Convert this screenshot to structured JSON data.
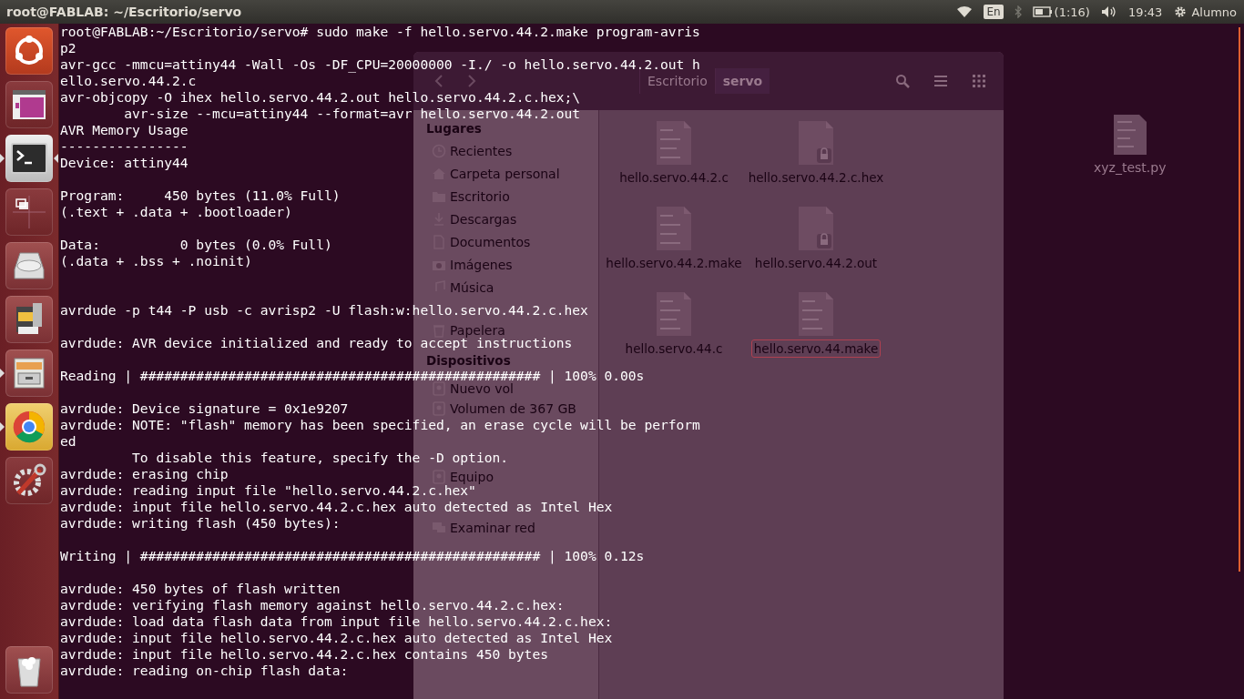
{
  "top_panel": {
    "title": "root@FABLAB: ~/Escritorio/servo",
    "keyboard": "En",
    "battery_time": "(1:16)",
    "clock": "19:43",
    "user": "Alumno"
  },
  "launcher": [
    {
      "kind": "ubuntu",
      "running": false,
      "focused": false
    },
    {
      "kind": "app",
      "running": false,
      "focused": false
    },
    {
      "kind": "terminal",
      "running": true,
      "focused": true
    },
    {
      "kind": "workspaces",
      "running": false,
      "focused": false
    },
    {
      "kind": "disk",
      "running": false,
      "focused": false
    },
    {
      "kind": "sdcard",
      "running": false,
      "focused": false
    },
    {
      "kind": "files",
      "running": true,
      "focused": false
    },
    {
      "kind": "chrome",
      "running": true,
      "focused": false
    },
    {
      "kind": "settings",
      "running": false,
      "focused": false
    },
    {
      "kind": "trash",
      "running": false,
      "focused": false
    }
  ],
  "desktop_icons": [
    {
      "label": "xyz_test.py"
    }
  ],
  "file_manager": {
    "path": [
      {
        "label": "Escritorio",
        "selected": false
      },
      {
        "label": "servo",
        "selected": true
      }
    ],
    "sidebar": [
      {
        "heading": "Lugares",
        "items": [
          {
            "label": "Recientes",
            "kind": "clock"
          },
          {
            "label": "Carpeta personal",
            "kind": "home"
          },
          {
            "label": "Escritorio",
            "kind": "folder"
          },
          {
            "label": "Descargas",
            "kind": "download"
          },
          {
            "label": "Documentos",
            "kind": "document"
          },
          {
            "label": "Imágenes",
            "kind": "camera"
          },
          {
            "label": "Música",
            "kind": "music"
          },
          {
            "label": "Papelera",
            "kind": "trash"
          }
        ]
      },
      {
        "heading": "Dispositivos",
        "items": [
          {
            "label": "Nuevo vol",
            "kind": "drive"
          },
          {
            "label": "Volumen de 367 GB",
            "kind": "drive"
          },
          {
            "label": "Equipo",
            "kind": "drive"
          }
        ]
      },
      {
        "items": [
          {
            "label": "Examinar red",
            "kind": "network"
          }
        ]
      }
    ],
    "files": [
      {
        "name": "hello.servo.44.2.c",
        "kind": "text",
        "selected": false
      },
      {
        "name": "hello.servo.44.2.c.hex",
        "kind": "locked",
        "selected": false
      },
      {
        "name": "hello.servo.44.2.make",
        "kind": "text",
        "selected": false
      },
      {
        "name": "hello.servo.44.2.out",
        "kind": "locked",
        "selected": false
      },
      {
        "name": "hello.servo.44.c",
        "kind": "text",
        "selected": false
      },
      {
        "name": "hello.servo.44.make",
        "kind": "text",
        "selected": true
      }
    ]
  },
  "terminal": {
    "lines": [
      {
        "kind": "text",
        "text": "root@FABLAB:~/Escritorio/servo# sudo make -f hello.servo.44.2.make program-avris"
      },
      {
        "kind": "text",
        "text": "p2"
      },
      {
        "kind": "text",
        "text": "avr-gcc -mmcu=attiny44 -Wall -Os -DF_CPU=20000000 -I./ -o hello.servo.44.2.out h"
      },
      {
        "kind": "text",
        "text": "ello.servo.44.2.c"
      },
      {
        "kind": "text",
        "text": "avr-objcopy -O ihex hello.servo.44.2.out hello.servo.44.2.c.hex;\\"
      },
      {
        "kind": "text",
        "text": "        avr-size --mcu=attiny44 --format=avr hello.servo.44.2.out"
      },
      {
        "kind": "text",
        "text": "AVR Memory Usage"
      },
      {
        "kind": "text",
        "text": "----------------"
      },
      {
        "kind": "text",
        "text": "Device: attiny44"
      },
      {
        "kind": "blank"
      },
      {
        "kind": "text",
        "text": "Program:     450 bytes (11.0% Full)"
      },
      {
        "kind": "text",
        "text": "(.text + .data + .bootloader)"
      },
      {
        "kind": "blank"
      },
      {
        "kind": "text",
        "text": "Data:          0 bytes (0.0% Full)"
      },
      {
        "kind": "text",
        "text": "(.data + .bss + .noinit)"
      },
      {
        "kind": "blank"
      },
      {
        "kind": "blank"
      },
      {
        "kind": "text",
        "text": "avrdude -p t44 -P usb -c avrisp2 -U flash:w:hello.servo.44.2.c.hex"
      },
      {
        "kind": "blank"
      },
      {
        "kind": "text",
        "text": "avrdude: AVR device initialized and ready to accept instructions"
      },
      {
        "kind": "blank"
      },
      {
        "kind": "text",
        "text": "Reading | ################################################## | 100% 0.00s"
      },
      {
        "kind": "blank"
      },
      {
        "kind": "text",
        "text": "avrdude: Device signature = 0x1e9207"
      },
      {
        "kind": "text",
        "text": "avrdude: NOTE: \"flash\" memory has been specified, an erase cycle will be perform"
      },
      {
        "kind": "text",
        "text": "ed"
      },
      {
        "kind": "text",
        "text": "         To disable this feature, specify the -D option."
      },
      {
        "kind": "text",
        "text": "avrdude: erasing chip"
      },
      {
        "kind": "text",
        "text": "avrdude: reading input file \"hello.servo.44.2.c.hex\""
      },
      {
        "kind": "text",
        "text": "avrdude: input file hello.servo.44.2.c.hex auto detected as Intel Hex"
      },
      {
        "kind": "text",
        "text": "avrdude: writing flash (450 bytes):"
      },
      {
        "kind": "blank"
      },
      {
        "kind": "text",
        "text": "Writing | ################################################## | 100% 0.12s"
      },
      {
        "kind": "blank"
      },
      {
        "kind": "text",
        "text": "avrdude: 450 bytes of flash written"
      },
      {
        "kind": "text",
        "text": "avrdude: verifying flash memory against hello.servo.44.2.c.hex:"
      },
      {
        "kind": "text",
        "text": "avrdude: load data flash data from input file hello.servo.44.2.c.hex:"
      },
      {
        "kind": "text",
        "text": "avrdude: input file hello.servo.44.2.c.hex auto detected as Intel Hex"
      },
      {
        "kind": "text",
        "text": "avrdude: input file hello.servo.44.2.c.hex contains 450 bytes"
      },
      {
        "kind": "text",
        "text": "avrdude: reading on-chip flash data:"
      }
    ]
  }
}
